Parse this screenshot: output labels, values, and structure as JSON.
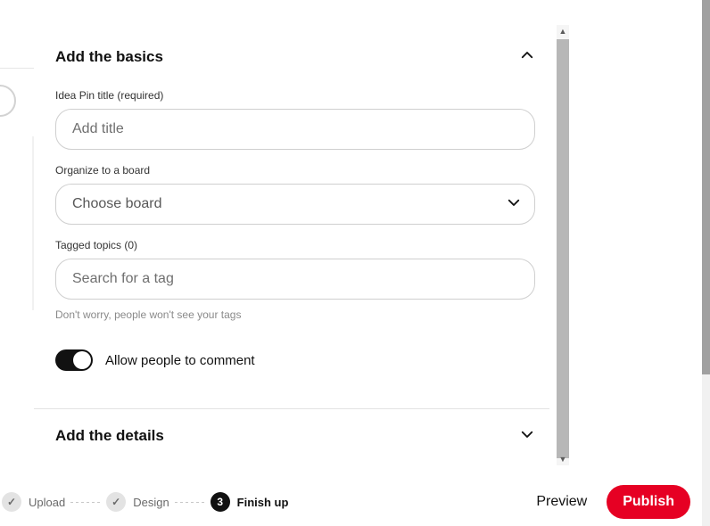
{
  "sections": {
    "basics": {
      "title": "Add the basics",
      "title_field": {
        "label": "Idea Pin title (required)",
        "placeholder": "Add title"
      },
      "board_field": {
        "label": "Organize to a board",
        "placeholder": "Choose board"
      },
      "tags_field": {
        "label": "Tagged topics (0)",
        "placeholder": "Search for a tag",
        "hint": "Don't worry, people won't see your tags"
      },
      "comments_toggle": {
        "label": "Allow people to comment",
        "on": true
      }
    },
    "details": {
      "title": "Add the details"
    }
  },
  "stepper": {
    "steps": [
      {
        "label": "Upload",
        "state": "done"
      },
      {
        "label": "Design",
        "state": "done"
      },
      {
        "label": "Finish up",
        "state": "current",
        "num": "3"
      }
    ]
  },
  "actions": {
    "preview": "Preview",
    "publish": "Publish"
  }
}
